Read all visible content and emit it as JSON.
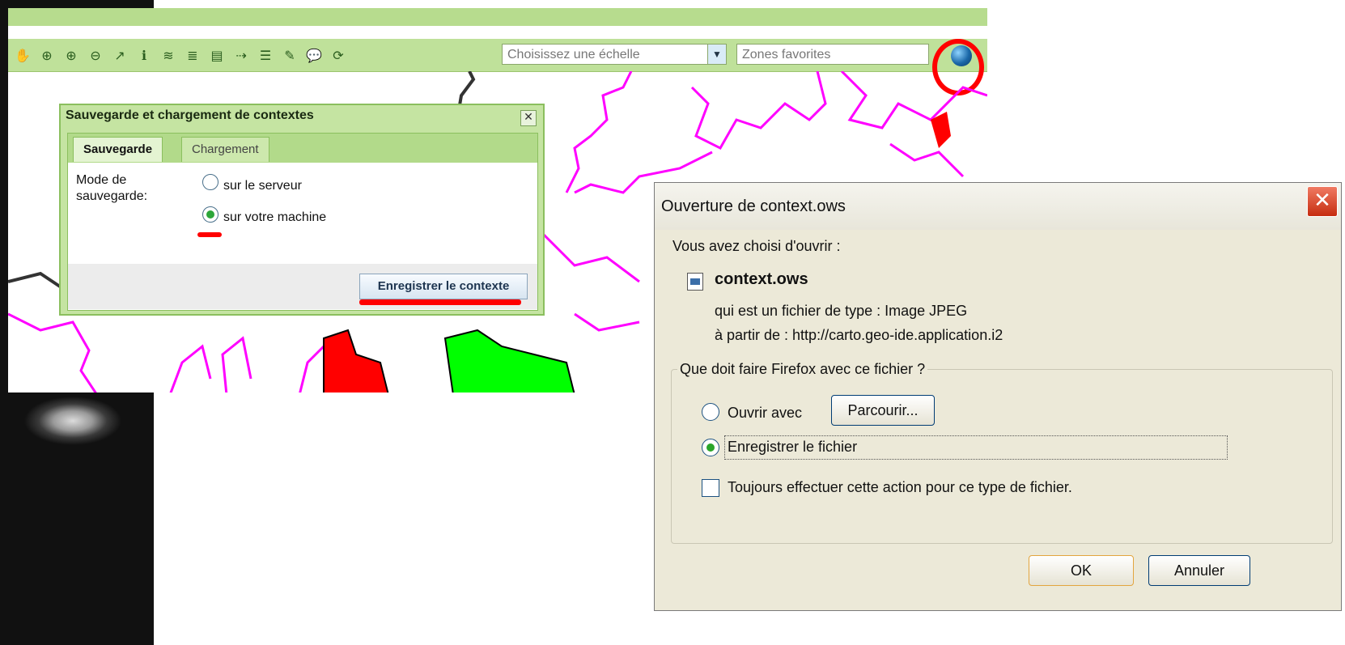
{
  "map_app": {
    "scale_placeholder": "Choisissez une échelle",
    "zones_placeholder": "Zones favorites",
    "toolbar_icons": [
      "pan-hand-icon",
      "zoom-extent-icon",
      "zoom-in-icon",
      "zoom-out-icon",
      "query-icon",
      "info-icon",
      "add-layer-icon",
      "layers-icon",
      "wfs-icon",
      "measure-icon",
      "legend-icon",
      "draw-icon",
      "annotation-icon",
      "refresh-icon"
    ]
  },
  "save_dialog": {
    "title": "Sauvegarde et chargement de contextes",
    "tabs": [
      "Sauvegarde",
      "Chargement"
    ],
    "mode_label": "Mode de sauvegarde:",
    "option_server": "sur le serveur",
    "option_local": "sur votre machine",
    "save_button": "Enregistrer le contexte"
  },
  "ff_dialog": {
    "title": "Ouverture de context.ows",
    "intro": "Vous avez choisi d'ouvrir :",
    "filename": "context.ows",
    "type_line": "qui est un fichier de type : Image JPEG",
    "from_line": "à partir de : http://carto.geo-ide.application.i2",
    "question": "Que doit faire Firefox avec ce fichier ?",
    "open_with": "Ouvrir avec",
    "browse": "Parcourir...",
    "save_file": "Enregistrer le fichier",
    "always": "Toujours effectuer cette action pour ce type de fichier.",
    "ok": "OK",
    "cancel": "Annuler"
  },
  "colors": {
    "toolbar_green": "#bfe19a",
    "boundary_magenta": "#ff00ff",
    "highlight_red": "#ff0000",
    "zone_green": "#00ff00"
  }
}
